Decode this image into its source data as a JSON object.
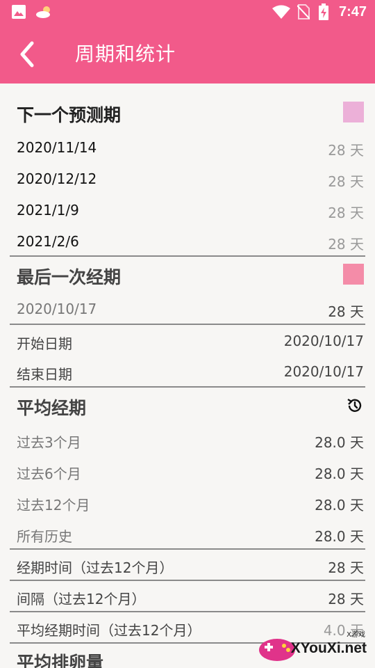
{
  "status_bar": {
    "time": "7:47"
  },
  "app_bar": {
    "title": "周期和统计"
  },
  "next_predicted": {
    "header": "下一个预测期",
    "swatch_color": "#ecb0d8",
    "rows": [
      {
        "date": "2020/11/14",
        "days": "28 天"
      },
      {
        "date": "2020/12/12",
        "days": "28 天"
      },
      {
        "date": "2021/1/9",
        "days": "28 天"
      },
      {
        "date": "2021/2/6",
        "days": "28 天"
      }
    ]
  },
  "last_period": {
    "header": "最后一次经期",
    "swatch_color": "#f48ca8",
    "date": "2020/10/17",
    "days": "28 天",
    "start_label": "开始日期",
    "start_value": "2020/10/17",
    "end_label": "结束日期",
    "end_value": "2020/10/17"
  },
  "average": {
    "header": "平均经期",
    "rows": [
      {
        "label": "过去3个月",
        "value": "28.0 天"
      },
      {
        "label": "过去6个月",
        "value": "28.0 天"
      },
      {
        "label": "过去12个月",
        "value": "28.0 天"
      },
      {
        "label": "所有历史",
        "value": "28.0 天"
      }
    ],
    "period_length_label": "经期时间（过去12个月）",
    "period_length_value": "28 天",
    "interval_label": "间隔（过去12个月）",
    "interval_value": "28 天",
    "avg_period_label": "平均经期时间（过去12个月）",
    "avg_period_value": "4.0 天"
  },
  "next_section_header": "平均排卵量",
  "watermark": {
    "text": "XYouXi.net",
    "small": "X游戏"
  }
}
